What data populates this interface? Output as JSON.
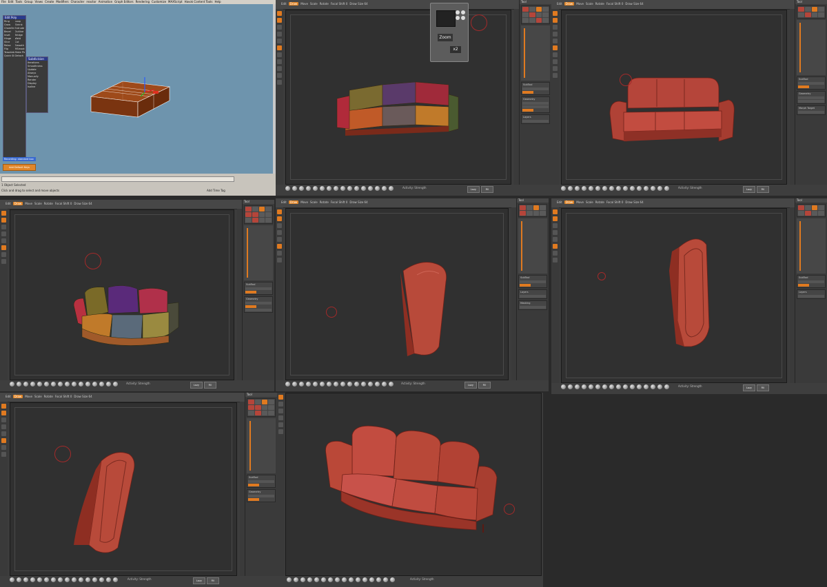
{
  "max": {
    "menu": [
      "File",
      "Edit",
      "Tools",
      "Group",
      "Views",
      "Create",
      "Modifiers",
      "Character",
      "reactor",
      "Animation",
      "Graph Editors",
      "Rendering",
      "Customize",
      "MAXScript",
      "Havok Content Tools",
      "Help"
    ],
    "panel_title": "Edit Poly",
    "panel_rows": [
      "Ring",
      "Loop",
      "Grow",
      "Shrink",
      "Chamfer",
      "Extrude",
      "Bevel",
      "Outline",
      "Inset",
      "Bridge",
      "Hinge",
      "Weld",
      "Slice",
      "Cut",
      "Relax",
      "Smooth",
      "Flip",
      "MSmooth",
      "Tesselate",
      "Make Planar",
      "Quick Slice",
      "Detach"
    ],
    "sub_title": "Subdivision",
    "sub_rows": [
      "Iterations",
      "Smoothness",
      "Update",
      "Always",
      "Manually",
      "Render",
      "Display",
      "Isoline"
    ],
    "blue_bar": "Recording: standard box",
    "orange_button": "Add Default Keys",
    "status": "1 Object Selected",
    "prompt": "Click and drag to select and move objects",
    "time_tag": "Add Time Tag"
  },
  "zb": {
    "tools": [
      "Edit",
      "Draw",
      "Move",
      "Scale",
      "Rotate"
    ],
    "strip_labels": [
      "Mrgb",
      "Rgb",
      "M",
      "Zadd",
      "Zsub",
      "Focal Shift",
      "Draw Size",
      "Z Intensity",
      "Rgb Intensity"
    ],
    "focal": "Focal Shift 0",
    "draw_size": "Draw Size 64",
    "activity": "Activity: Strength",
    "local_sym": "Local",
    "tool_header": "Tool",
    "subtool": "SubTool",
    "geometry": "Geometry",
    "layers": "Layers",
    "morph": "Morph Target",
    "masking": "Masking",
    "zoom": "Zoom",
    "key": "x2",
    "btn_a": "Lazy",
    "btn_b": "Fill"
  }
}
